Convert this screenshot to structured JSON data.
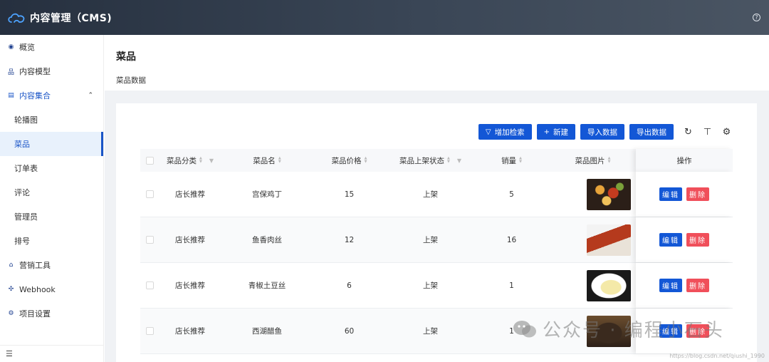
{
  "header": {
    "title": "内容管理（CMS)",
    "help_icon": "question-circle-icon"
  },
  "sidebar": {
    "items": [
      {
        "label": "概览",
        "icon": "eye-icon"
      },
      {
        "label": "内容模型",
        "icon": "model-icon"
      },
      {
        "label": "内容集合",
        "icon": "collection-icon",
        "expanded": true
      },
      {
        "label": "营销工具",
        "icon": "shop-icon"
      },
      {
        "label": "Webhook",
        "icon": "webhook-icon"
      },
      {
        "label": "项目设置",
        "icon": "gear-icon"
      }
    ],
    "sub_items": [
      "轮播图",
      "菜品",
      "订单表",
      "评论",
      "管理员",
      "排号"
    ],
    "active_sub": "菜品",
    "collapse_icon": "menu-fold-icon"
  },
  "page": {
    "title": "菜品",
    "subtitle": "菜品数据"
  },
  "toolbar": {
    "filter_label": "增加检索",
    "new_label": "新建",
    "import_label": "导入数据",
    "export_label": "导出数据"
  },
  "table": {
    "columns": [
      "菜品分类",
      "菜品名",
      "菜品价格",
      "菜品上架状态",
      "销量",
      "菜品图片",
      "操作"
    ],
    "rows": [
      {
        "category": "店长推荐",
        "name": "宫保鸡丁",
        "price": "15",
        "status": "上架",
        "sales": "5"
      },
      {
        "category": "店长推荐",
        "name": "鱼香肉丝",
        "price": "12",
        "status": "上架",
        "sales": "16"
      },
      {
        "category": "店长推荐",
        "name": "青椒土豆丝",
        "price": "6",
        "status": "上架",
        "sales": "1"
      },
      {
        "category": "店长推荐",
        "name": "西湖醋鱼",
        "price": "60",
        "status": "上架",
        "sales": "1"
      }
    ],
    "edit_label": "编辑",
    "delete_label": "删除"
  },
  "watermark": {
    "text": "公众号 · 编程小石头",
    "url": "https://blog.csdn.net/qiushi_1990"
  },
  "colors": {
    "primary": "#1357d6",
    "danger": "#f04f5a",
    "header_bg": "#26303f"
  }
}
